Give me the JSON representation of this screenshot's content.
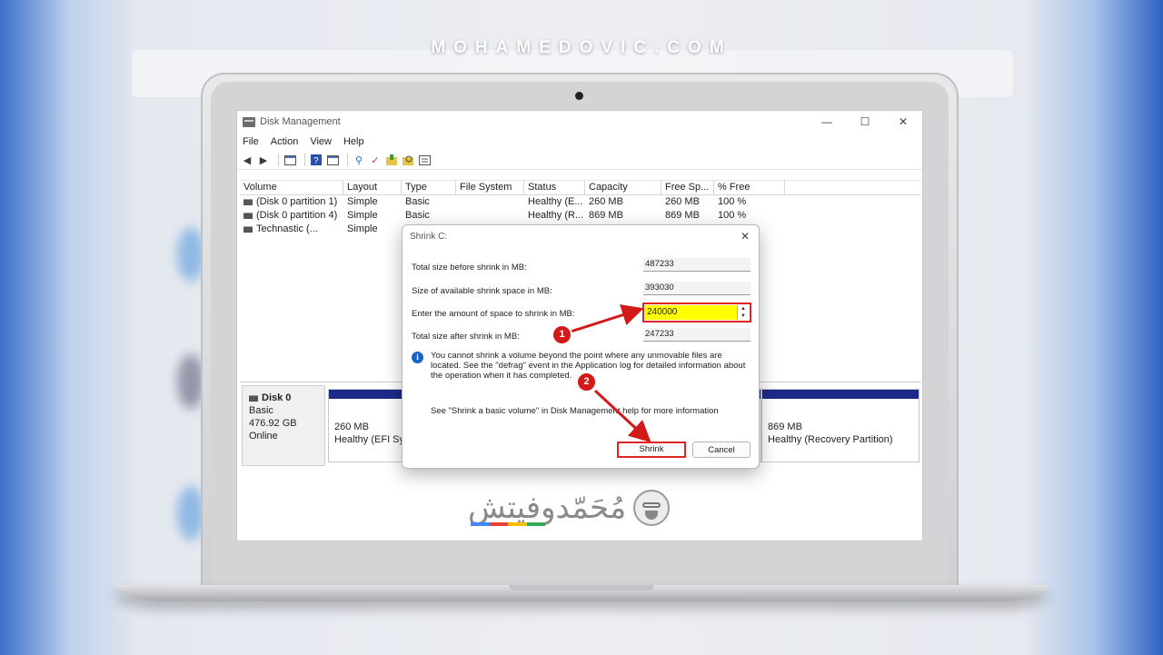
{
  "site": {
    "title": "MOHAMEDOVIC.COM"
  },
  "window": {
    "title": "Disk Management",
    "controls": {
      "minimize": "—",
      "maximize": "☐",
      "close": "✕"
    },
    "menu": [
      "File",
      "Action",
      "View",
      "Help"
    ]
  },
  "volumes": {
    "columns": [
      "Volume",
      "Layout",
      "Type",
      "File System",
      "Status",
      "Capacity",
      "Free Sp...",
      "% Free"
    ],
    "rows": [
      [
        "(Disk 0 partition 1)",
        "Simple",
        "Basic",
        "",
        "Healthy (E...",
        "260 MB",
        "260 MB",
        "100 %"
      ],
      [
        "(Disk 0 partition 4)",
        "Simple",
        "Basic",
        "",
        "Healthy (R...",
        "869 MB",
        "869 MB",
        "100 %"
      ],
      [
        "Technastic (...",
        "Simple",
        "",
        "",
        "",
        "",
        "",
        ""
      ]
    ]
  },
  "disk": {
    "name": "Disk 0",
    "type": "Basic",
    "size": "476.92 GB",
    "state": "Online",
    "partitions": [
      {
        "size": "260 MB",
        "status": "Healthy (EFI Syst"
      },
      {
        "size": "869 MB",
        "status": "Healthy (Recovery Partition)"
      }
    ]
  },
  "dialog": {
    "title": "Shrink C:",
    "close": "✕",
    "total_before_label": "Total size before shrink in MB:",
    "total_before_value": "487233",
    "available_label": "Size of available shrink space in MB:",
    "available_value": "393030",
    "enter_label": "Enter the amount of space to shrink in MB:",
    "enter_value": "240000",
    "after_label": "Total size after shrink in MB:",
    "after_value": "247233",
    "info_icon": "i",
    "info_text": "You cannot shrink a volume beyond the point where any unmovable files are located. See the \"defrag\" event in the Application log for detailed information about the operation when it has completed.",
    "see_text": "See \"Shrink a basic volume\" in Disk Management help for more information",
    "shrink_button": "Shrink",
    "cancel_button": "Cancel"
  },
  "annotations": {
    "step1": "1",
    "step2": "2",
    "color": "#d41919"
  },
  "watermark": {
    "text": "مُحَمّدوفيتش",
    "stripe_colors": [
      "#4285f4",
      "#ea4335",
      "#fbbc05",
      "#34a853"
    ]
  }
}
